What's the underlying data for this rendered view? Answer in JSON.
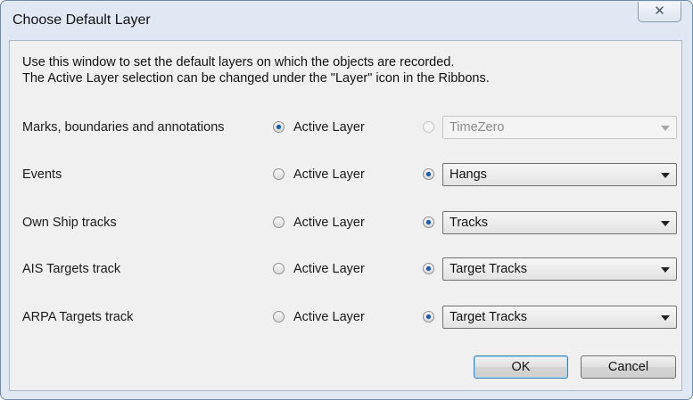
{
  "window": {
    "title": "Choose Default Layer",
    "close_glyph": "✕"
  },
  "intro": {
    "line1": "Use this window to set the default layers on which the objects are recorded.",
    "line2": "The Active Layer selection can be changed under the \"Layer\" icon in the Ribbons."
  },
  "rows": [
    {
      "label": "Marks, boundaries and annotations",
      "active_label": "Active Layer",
      "active_selected": true,
      "layer_value": "TimeZero",
      "layer_enabled": false
    },
    {
      "label": "Events",
      "active_label": "Active Layer",
      "active_selected": false,
      "layer_value": "Hangs",
      "layer_enabled": true
    },
    {
      "label": "Own Ship tracks",
      "active_label": "Active Layer",
      "active_selected": false,
      "layer_value": "Tracks",
      "layer_enabled": true
    },
    {
      "label": "AIS Targets track",
      "active_label": "Active Layer",
      "active_selected": false,
      "layer_value": "Target Tracks",
      "layer_enabled": true
    },
    {
      "label": "ARPA Targets track",
      "active_label": "Active Layer",
      "active_selected": false,
      "layer_value": "Target Tracks",
      "layer_enabled": true
    }
  ],
  "buttons": {
    "ok": "OK",
    "cancel": "Cancel"
  }
}
